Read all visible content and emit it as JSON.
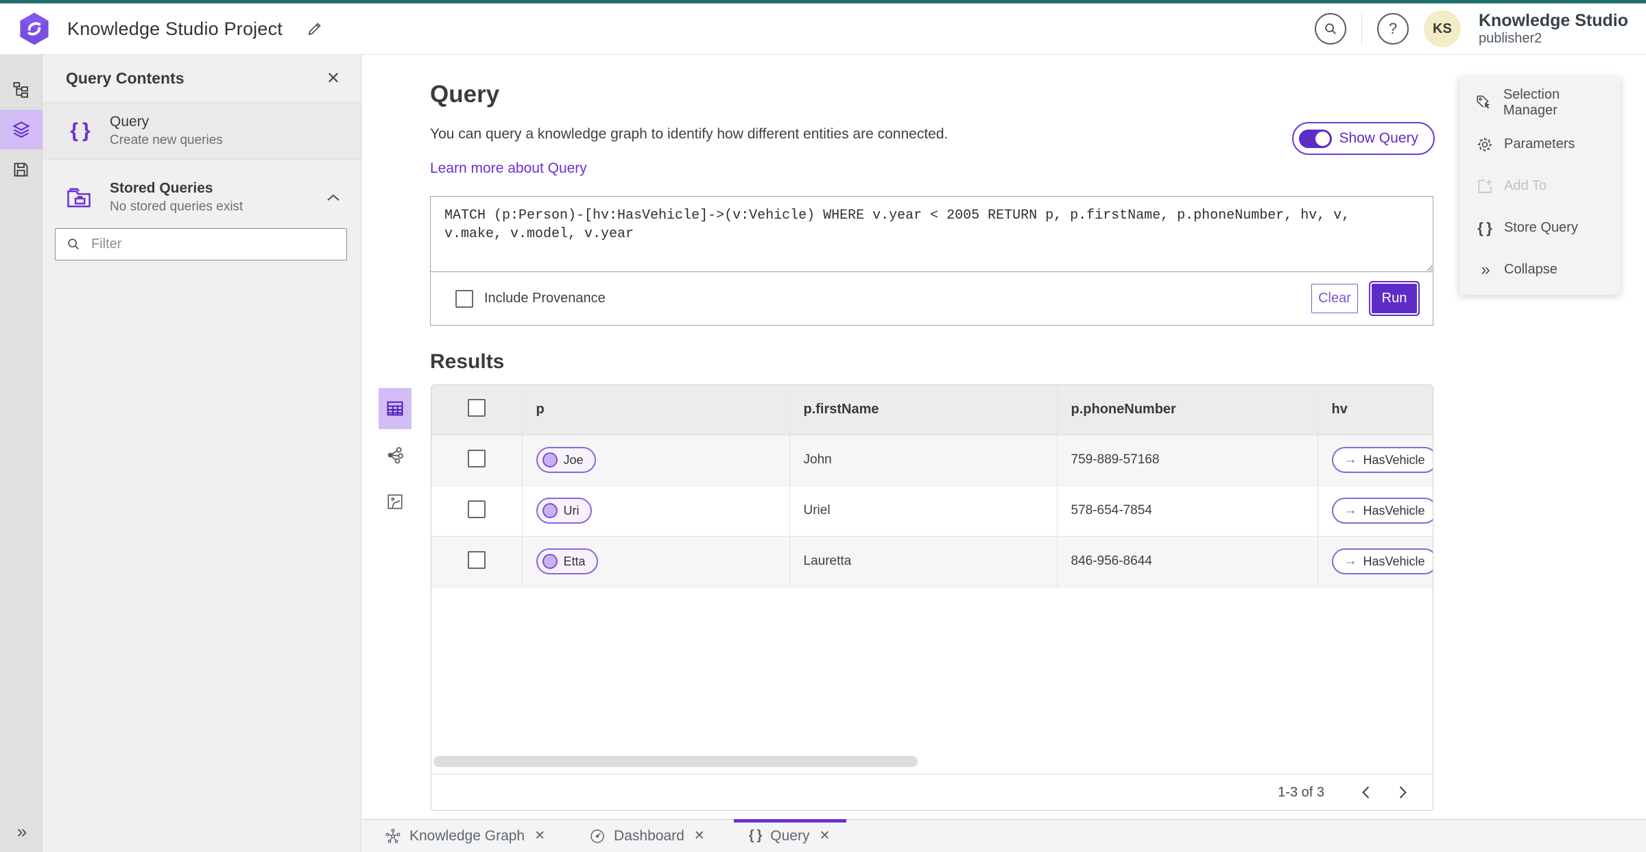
{
  "colors": {
    "accent_purple": "#6d2ed6",
    "button_purple": "#5d2cc6",
    "active_icon_bg": "#d2bdf6",
    "teal_strip": "#1f6e6e",
    "avatar_bg": "#f2edc6"
  },
  "header": {
    "title": "Knowledge Studio Project",
    "avatar_initials": "KS",
    "account_name": "Knowledge Studio",
    "account_user": "publisher2",
    "icons": [
      "search-icon",
      "help-icon"
    ]
  },
  "left_rail": {
    "icons": [
      "tree-view-icon",
      "layers-icon",
      "save-icon",
      "expand-chevrons-icon"
    ],
    "active_icon": "layers-icon"
  },
  "panel": {
    "title": "Query Contents",
    "query_item": {
      "title": "Query",
      "subtitle": "Create new queries",
      "icon": "braces-icon"
    },
    "stored": {
      "title": "Stored Queries",
      "subtitle": "No stored queries exist",
      "icon": "folder-icon"
    },
    "filter_placeholder": "Filter"
  },
  "query_section": {
    "heading": "Query",
    "description": "You can query a knowledge graph to identify how different entities are connected.",
    "learn_more": "Learn more about Query",
    "show_query_label": "Show Query",
    "query_text": "MATCH (p:Person)-[hv:HasVehicle]->(v:Vehicle) WHERE v.year < 2005 RETURN p, p.firstName, p.phoneNumber, hv, v,\nv.make, v.model, v.year",
    "include_provenance_label": "Include Provenance",
    "clear_label": "Clear",
    "run_label": "Run"
  },
  "results": {
    "heading": "Results",
    "view_icons": [
      "table-view-icon",
      "graph-view-icon",
      "map-view-icon"
    ],
    "columns": [
      "p",
      "p.firstName",
      "p.phoneNumber",
      "hv"
    ],
    "rows": [
      {
        "p": "Joe",
        "firstName": "John",
        "phoneNumber": "759-889-57168",
        "hv": "HasVehicle"
      },
      {
        "p": "Uri",
        "firstName": "Uriel",
        "phoneNumber": "578-654-7854",
        "hv": "HasVehicle"
      },
      {
        "p": "Etta",
        "firstName": "Lauretta",
        "phoneNumber": "846-956-8644",
        "hv": "HasVehicle"
      }
    ],
    "pagination": "1-3 of 3"
  },
  "right_menu": {
    "items": [
      {
        "label": "Selection Manager",
        "icon": "tag-cursor-icon",
        "disabled": false
      },
      {
        "label": "Parameters",
        "icon": "gear-icon",
        "disabled": false
      },
      {
        "label": "Add To",
        "icon": "add-to-icon",
        "disabled": true
      },
      {
        "label": "Store Query",
        "icon": "braces-icon",
        "disabled": false
      },
      {
        "label": "Collapse",
        "icon": "chevrons-right-icon",
        "disabled": false
      }
    ]
  },
  "bottom_tabs": [
    {
      "label": "Knowledge Graph",
      "icon": "knowledge-graph-icon",
      "active": false
    },
    {
      "label": "Dashboard",
      "icon": "dashboard-icon",
      "active": false
    },
    {
      "label": "Query",
      "icon": "braces-icon",
      "active": true
    }
  ]
}
